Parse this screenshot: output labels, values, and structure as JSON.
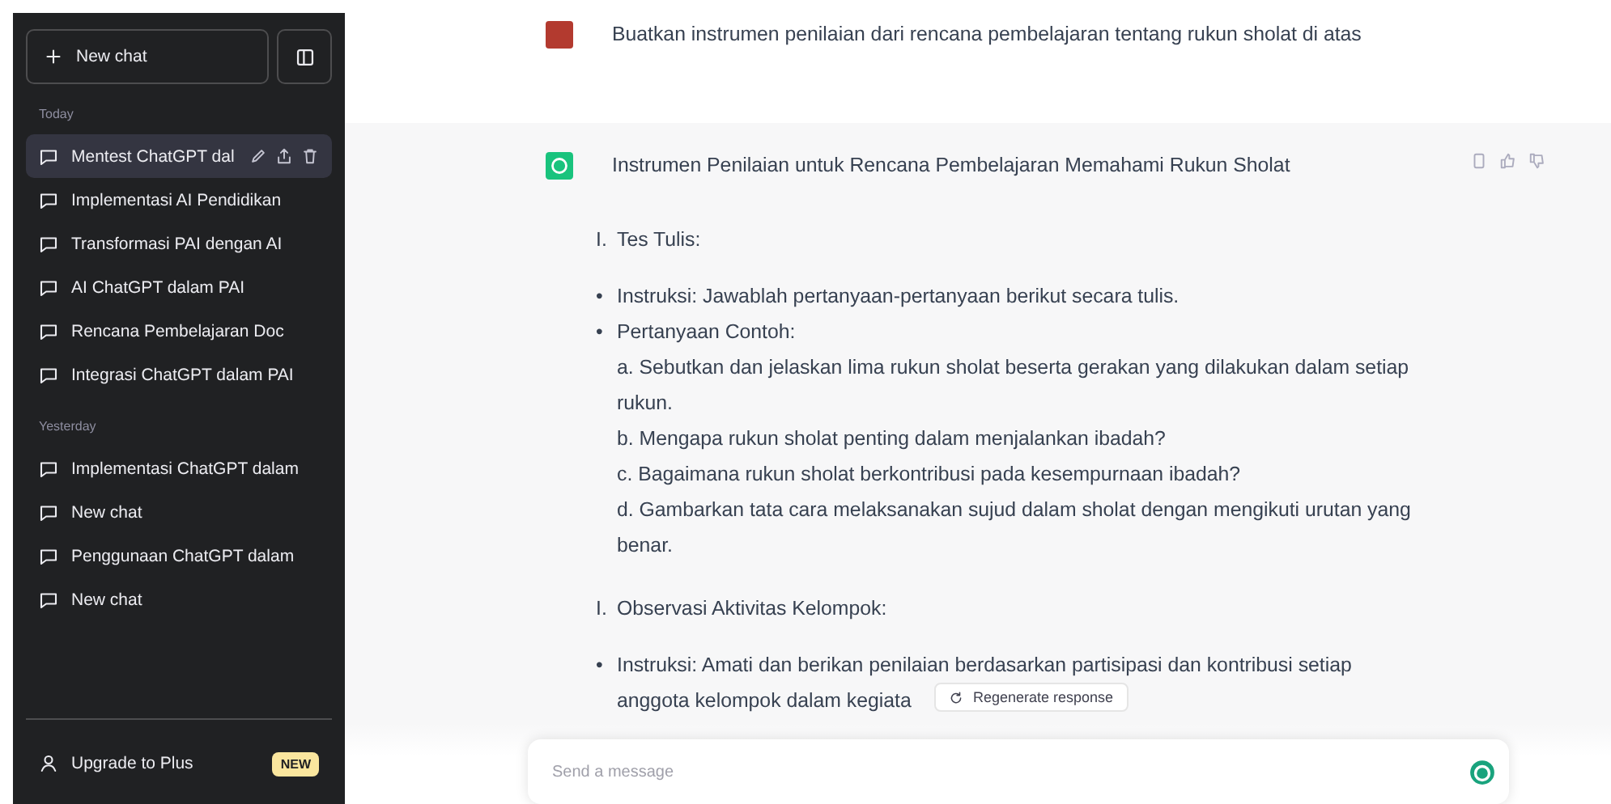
{
  "sidebar": {
    "new_chat_button": "New chat",
    "sections": [
      {
        "label": "Today",
        "items": [
          {
            "title": "Mentest ChatGPT dal",
            "selected": true
          },
          {
            "title": "Implementasi AI Pendidikan",
            "selected": false
          },
          {
            "title": "Transformasi PAI dengan AI",
            "selected": false
          },
          {
            "title": "AI ChatGPT dalam PAI",
            "selected": false
          },
          {
            "title": "Rencana Pembelajaran Doc",
            "selected": false
          },
          {
            "title": "Integrasi ChatGPT dalam PAI",
            "selected": false
          }
        ]
      },
      {
        "label": "Yesterday",
        "items": [
          {
            "title": "Implementasi ChatGPT dalam",
            "selected": false
          },
          {
            "title": "New chat",
            "selected": false
          },
          {
            "title": "Penggunaan ChatGPT dalam",
            "selected": false
          },
          {
            "title": "New chat",
            "selected": false
          }
        ]
      }
    ],
    "upgrade": {
      "label": "Upgrade to Plus",
      "badge": "NEW"
    }
  },
  "conversation": {
    "user_message": {
      "text": "Buatkan instrumen penilaian dari rencana pembelajaran tentang rukun sholat di atas"
    },
    "assistant_message": {
      "heading": "Instrumen Penilaian untuk Rencana Pembelajaran Memahami Rukun Sholat",
      "blocks": [
        {
          "kind": "section",
          "marker": "I.",
          "text": "Tes Tulis:"
        },
        {
          "kind": "bullet",
          "marker": "•",
          "text": "Instruksi: Jawablah pertanyaan-pertanyaan berikut secara tulis."
        },
        {
          "kind": "bullet",
          "marker": "•",
          "text": "Pertanyaan Contoh:"
        },
        {
          "kind": "line",
          "text": "a. Sebutkan dan jelaskan lima rukun sholat beserta gerakan yang dilakukan dalam setiap rukun."
        },
        {
          "kind": "line",
          "text": "b. Mengapa rukun sholat penting dalam menjalankan ibadah?"
        },
        {
          "kind": "line",
          "text": "c. Bagaimana rukun sholat berkontribusi pada kesempurnaan ibadah?"
        },
        {
          "kind": "line",
          "text": "d. Gambarkan tata cara melaksanakan sujud dalam sholat dengan mengikuti urutan yang benar."
        },
        {
          "kind": "section",
          "marker": "I.",
          "text": "Observasi Aktivitas Kelompok:"
        },
        {
          "kind": "bullet",
          "marker": "•",
          "text": "Instruksi: Amati dan berikan penilaian berdasarkan partisipasi dan kontribusi setiap"
        },
        {
          "kind": "line",
          "text": "anggota kelompok dalam kegiata"
        }
      ]
    }
  },
  "regenerate_button": "Regenerate response",
  "composer": {
    "placeholder": "Send a message"
  }
}
